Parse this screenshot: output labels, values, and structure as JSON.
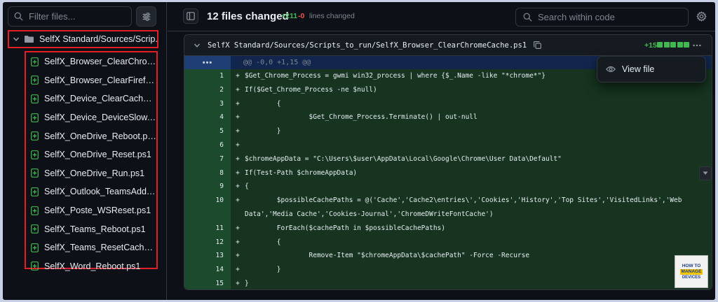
{
  "sidebar": {
    "filter_placeholder": "Filter files...",
    "folder_label": "SelfX Standard/Sources/Scrip...",
    "files": [
      {
        "label": "SelfX_Browser_ClearChrome..."
      },
      {
        "label": "SelfX_Browser_ClearFirefoxC..."
      },
      {
        "label": "SelfX_Device_ClearCache.ps1"
      },
      {
        "label": "SelfX_Device_DeviceSlow.ps1"
      },
      {
        "label": "SelfX_OneDrive_Reboot.ps1"
      },
      {
        "label": "SelfX_OneDrive_Reset.ps1"
      },
      {
        "label": "SelfX_OneDrive_Run.ps1"
      },
      {
        "label": "SelfX_Outlook_TeamsAddIn...."
      },
      {
        "label": "SelfX_Poste_WSReset.ps1"
      },
      {
        "label": "SelfX_Teams_Reboot.ps1"
      },
      {
        "label": "SelfX_Teams_ResetCache.ps1"
      },
      {
        "label": "SelfX_Word_Reboot.ps1"
      }
    ]
  },
  "header": {
    "files_changed": "12 files changed",
    "additions": "+211",
    "deletions": "-0",
    "lines_changed_label": "lines changed",
    "search_placeholder": "Search within code"
  },
  "diff": {
    "path": "SelfX Standard/Sources/Scripts_to_run/SelfX_Browser_ClearChromeCache.ps1",
    "plus_count": "+15",
    "hunk_dots": "•••",
    "hunk_header": "@@ -0,0 +1,15 @@",
    "lines": [
      {
        "num": "1",
        "sign": "+",
        "code": "$Get_Chrome_Process = gwmi win32_process | where {$_.Name -like \"*chrome*\"}"
      },
      {
        "num": "2",
        "sign": "+",
        "code": "If($Get_Chrome_Process -ne $null)"
      },
      {
        "num": "3",
        "sign": "+",
        "code": "        {"
      },
      {
        "num": "4",
        "sign": "+",
        "code": "                $Get_Chrome_Process.Terminate() | out-null"
      },
      {
        "num": "5",
        "sign": "+",
        "code": "        }"
      },
      {
        "num": "6",
        "sign": "+",
        "code": ""
      },
      {
        "num": "7",
        "sign": "+",
        "code": "$chromeAppData = \"C:\\Users\\$user\\AppData\\Local\\Google\\Chrome\\User Data\\Default\""
      },
      {
        "num": "8",
        "sign": "+",
        "code": "If(Test-Path $chromeAppData)"
      },
      {
        "num": "9",
        "sign": "+",
        "code": "{"
      },
      {
        "num": "10",
        "sign": "+",
        "code": "        $possibleCachePaths = @('Cache','Cache2\\entries\\','Cookies','History','Top Sites','VisitedLinks','Web Data','Media Cache','Cookies-Journal','ChromeDWriteFontCache')"
      },
      {
        "num": "11",
        "sign": "+",
        "code": "        ForEach($cachePath in $possibleCachePaths)"
      },
      {
        "num": "12",
        "sign": "+",
        "code": "        {"
      },
      {
        "num": "13",
        "sign": "+",
        "code": "                Remove-Item \"$chromeAppData\\$cachePath\" -Force -Recurse"
      },
      {
        "num": "14",
        "sign": "+",
        "code": "        }"
      },
      {
        "num": "15",
        "sign": "+",
        "code": "}"
      }
    ]
  },
  "menu": {
    "view_file": "View file"
  },
  "logo": {
    "line1": "HOW TO",
    "line2": "MANAGE",
    "line3": "DEVICES"
  },
  "colors": {
    "accent_red": "#e31e24",
    "addition_green": "#3fb950",
    "deletion_red": "#f85149"
  }
}
